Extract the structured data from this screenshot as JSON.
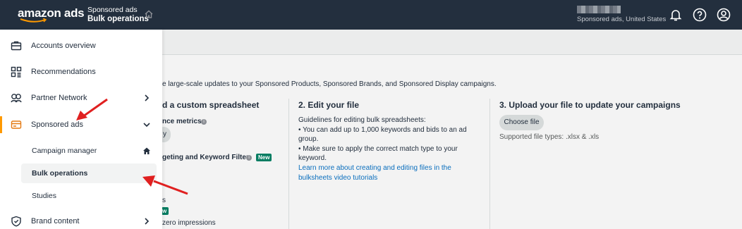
{
  "header": {
    "logo": "amazon ads",
    "breadcrumb_parent": "Sponsored ads",
    "breadcrumb_current": "Bulk operations",
    "account_region": "Sponsored ads, United States"
  },
  "sidebar": {
    "items": [
      {
        "label": "Accounts overview",
        "icon": "briefcase-icon"
      },
      {
        "label": "Recommendations",
        "icon": "grid-icon"
      },
      {
        "label": "Partner Network",
        "icon": "handshake-icon"
      },
      {
        "label": "Sponsored ads",
        "icon": "card-icon"
      },
      {
        "label": "Brand content",
        "icon": "shield-icon"
      }
    ],
    "subitems": [
      {
        "label": "Campaign manager"
      },
      {
        "label": "Bulk operations"
      },
      {
        "label": "Studies"
      }
    ]
  },
  "main": {
    "intro": "e large-scale updates to your Sponsored Products, Sponsored Brands, and Sponsored Display campaigns.",
    "step1": {
      "heading": "d a custom spreadsheet",
      "line1": "nce metrics",
      "pill": "y",
      "line2": "geting and Keyword Filter",
      "badge1": "New",
      "line3": "s",
      "badge2": "w",
      "line4": "zero impressions"
    },
    "step2": {
      "heading": "2. Edit your file",
      "guidelines": "Guidelines for editing bulk spreadsheets:",
      "bullet1a": "• You can add up to 1,000 keywords and bids to an ad",
      "bullet1b": "group.",
      "bullet2a": "• Make sure to apply the correct match type to your",
      "bullet2b": "keyword.",
      "link1": "Learn more about creating and editing files in the",
      "link2": "bulksheets video tutorials"
    },
    "step3": {
      "heading": "3. Upload your file to update your campaigns",
      "button": "Choose file",
      "filetypes": "Supported file types: .xlsx & .xls"
    }
  },
  "colors": {
    "topbar": "#232f3e",
    "active_indicator": "#ff9900",
    "link": "#0a6ebd",
    "annotation_arrow": "#e02020"
  }
}
